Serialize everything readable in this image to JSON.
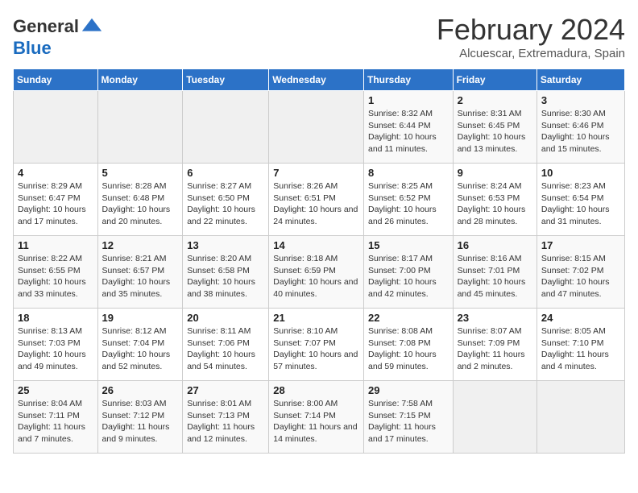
{
  "header": {
    "logo_line1": "General",
    "logo_line2": "Blue",
    "title": "February 2024",
    "subtitle": "Alcuescar, Extremadura, Spain"
  },
  "days_of_week": [
    "Sunday",
    "Monday",
    "Tuesday",
    "Wednesday",
    "Thursday",
    "Friday",
    "Saturday"
  ],
  "weeks": [
    [
      {
        "day": "",
        "info": ""
      },
      {
        "day": "",
        "info": ""
      },
      {
        "day": "",
        "info": ""
      },
      {
        "day": "",
        "info": ""
      },
      {
        "day": "1",
        "info": "Sunrise: 8:32 AM\nSunset: 6:44 PM\nDaylight: 10 hours and 11 minutes."
      },
      {
        "day": "2",
        "info": "Sunrise: 8:31 AM\nSunset: 6:45 PM\nDaylight: 10 hours and 13 minutes."
      },
      {
        "day": "3",
        "info": "Sunrise: 8:30 AM\nSunset: 6:46 PM\nDaylight: 10 hours and 15 minutes."
      }
    ],
    [
      {
        "day": "4",
        "info": "Sunrise: 8:29 AM\nSunset: 6:47 PM\nDaylight: 10 hours and 17 minutes."
      },
      {
        "day": "5",
        "info": "Sunrise: 8:28 AM\nSunset: 6:48 PM\nDaylight: 10 hours and 20 minutes."
      },
      {
        "day": "6",
        "info": "Sunrise: 8:27 AM\nSunset: 6:50 PM\nDaylight: 10 hours and 22 minutes."
      },
      {
        "day": "7",
        "info": "Sunrise: 8:26 AM\nSunset: 6:51 PM\nDaylight: 10 hours and 24 minutes."
      },
      {
        "day": "8",
        "info": "Sunrise: 8:25 AM\nSunset: 6:52 PM\nDaylight: 10 hours and 26 minutes."
      },
      {
        "day": "9",
        "info": "Sunrise: 8:24 AM\nSunset: 6:53 PM\nDaylight: 10 hours and 28 minutes."
      },
      {
        "day": "10",
        "info": "Sunrise: 8:23 AM\nSunset: 6:54 PM\nDaylight: 10 hours and 31 minutes."
      }
    ],
    [
      {
        "day": "11",
        "info": "Sunrise: 8:22 AM\nSunset: 6:55 PM\nDaylight: 10 hours and 33 minutes."
      },
      {
        "day": "12",
        "info": "Sunrise: 8:21 AM\nSunset: 6:57 PM\nDaylight: 10 hours and 35 minutes."
      },
      {
        "day": "13",
        "info": "Sunrise: 8:20 AM\nSunset: 6:58 PM\nDaylight: 10 hours and 38 minutes."
      },
      {
        "day": "14",
        "info": "Sunrise: 8:18 AM\nSunset: 6:59 PM\nDaylight: 10 hours and 40 minutes."
      },
      {
        "day": "15",
        "info": "Sunrise: 8:17 AM\nSunset: 7:00 PM\nDaylight: 10 hours and 42 minutes."
      },
      {
        "day": "16",
        "info": "Sunrise: 8:16 AM\nSunset: 7:01 PM\nDaylight: 10 hours and 45 minutes."
      },
      {
        "day": "17",
        "info": "Sunrise: 8:15 AM\nSunset: 7:02 PM\nDaylight: 10 hours and 47 minutes."
      }
    ],
    [
      {
        "day": "18",
        "info": "Sunrise: 8:13 AM\nSunset: 7:03 PM\nDaylight: 10 hours and 49 minutes."
      },
      {
        "day": "19",
        "info": "Sunrise: 8:12 AM\nSunset: 7:04 PM\nDaylight: 10 hours and 52 minutes."
      },
      {
        "day": "20",
        "info": "Sunrise: 8:11 AM\nSunset: 7:06 PM\nDaylight: 10 hours and 54 minutes."
      },
      {
        "day": "21",
        "info": "Sunrise: 8:10 AM\nSunset: 7:07 PM\nDaylight: 10 hours and 57 minutes."
      },
      {
        "day": "22",
        "info": "Sunrise: 8:08 AM\nSunset: 7:08 PM\nDaylight: 10 hours and 59 minutes."
      },
      {
        "day": "23",
        "info": "Sunrise: 8:07 AM\nSunset: 7:09 PM\nDaylight: 11 hours and 2 minutes."
      },
      {
        "day": "24",
        "info": "Sunrise: 8:05 AM\nSunset: 7:10 PM\nDaylight: 11 hours and 4 minutes."
      }
    ],
    [
      {
        "day": "25",
        "info": "Sunrise: 8:04 AM\nSunset: 7:11 PM\nDaylight: 11 hours and 7 minutes."
      },
      {
        "day": "26",
        "info": "Sunrise: 8:03 AM\nSunset: 7:12 PM\nDaylight: 11 hours and 9 minutes."
      },
      {
        "day": "27",
        "info": "Sunrise: 8:01 AM\nSunset: 7:13 PM\nDaylight: 11 hours and 12 minutes."
      },
      {
        "day": "28",
        "info": "Sunrise: 8:00 AM\nSunset: 7:14 PM\nDaylight: 11 hours and 14 minutes."
      },
      {
        "day": "29",
        "info": "Sunrise: 7:58 AM\nSunset: 7:15 PM\nDaylight: 11 hours and 17 minutes."
      },
      {
        "day": "",
        "info": ""
      },
      {
        "day": "",
        "info": ""
      }
    ]
  ]
}
